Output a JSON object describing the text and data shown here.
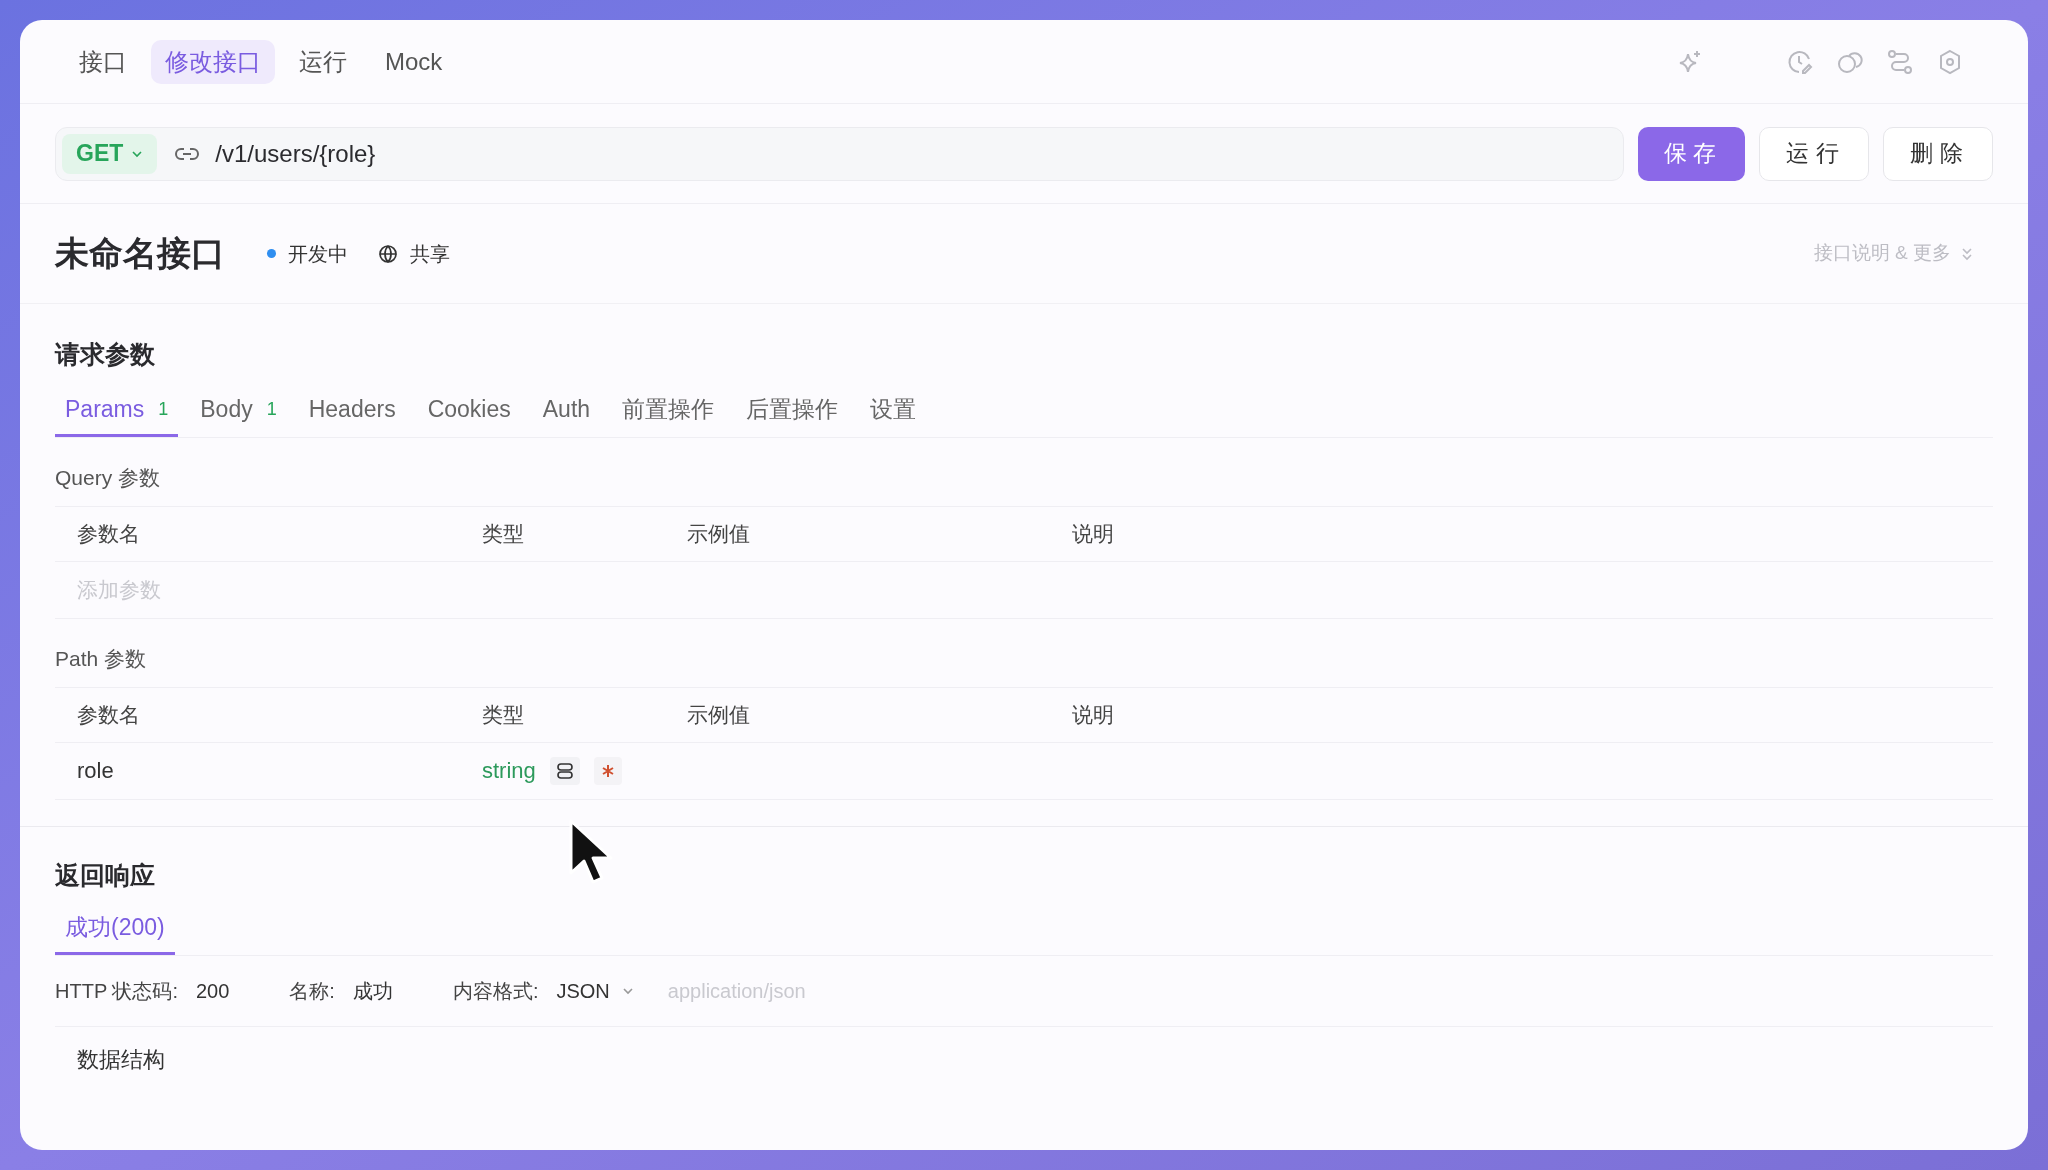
{
  "top_tabs": [
    {
      "label": "接口",
      "selected": false
    },
    {
      "label": "修改接口",
      "selected": true
    },
    {
      "label": "运行",
      "selected": false
    },
    {
      "label": "Mock",
      "selected": false
    }
  ],
  "request": {
    "method": "GET",
    "path": "/v1/users/{role}"
  },
  "actions": [
    {
      "label": "保存",
      "kind": "primary"
    },
    {
      "label": "运行",
      "kind": "default"
    },
    {
      "label": "删除",
      "kind": "default"
    }
  ],
  "endpoint": {
    "name": "未命名接口",
    "status": {
      "label": "开发中",
      "color": "#2f8ef0"
    },
    "share": "共享",
    "more": "接口说明 & 更多"
  },
  "request_params": {
    "title": "请求参数",
    "tabs": [
      {
        "label": "Params",
        "count": "1",
        "selected": true
      },
      {
        "label": "Body",
        "count": "1",
        "selected": false
      },
      {
        "label": "Headers",
        "selected": false
      },
      {
        "label": "Cookies",
        "selected": false
      },
      {
        "label": "Auth",
        "selected": false
      },
      {
        "label": "前置操作",
        "selected": false
      },
      {
        "label": "后置操作",
        "selected": false
      },
      {
        "label": "设置",
        "selected": false
      }
    ],
    "sections": [
      {
        "title": "Query 参数",
        "columns": [
          "参数名",
          "类型",
          "示例值",
          "说明"
        ],
        "placeholder": "添加参数"
      },
      {
        "title": "Path 参数",
        "columns": [
          "参数名",
          "类型",
          "示例值",
          "说明"
        ],
        "rows": [
          {
            "name": "role",
            "type": "string",
            "required": true
          }
        ]
      }
    ]
  },
  "response": {
    "title": "返回响应",
    "tabs": [
      {
        "label": "成功(200)",
        "selected": true
      }
    ],
    "fields": [
      {
        "label": "HTTP 状态码:",
        "value": "200",
        "kind": "text"
      },
      {
        "label": "名称:",
        "value": "成功",
        "kind": "text"
      },
      {
        "label": "内容格式:",
        "value": "JSON",
        "kind": "select"
      }
    ],
    "content_type": "application/json",
    "schema_title": "数据结构"
  }
}
